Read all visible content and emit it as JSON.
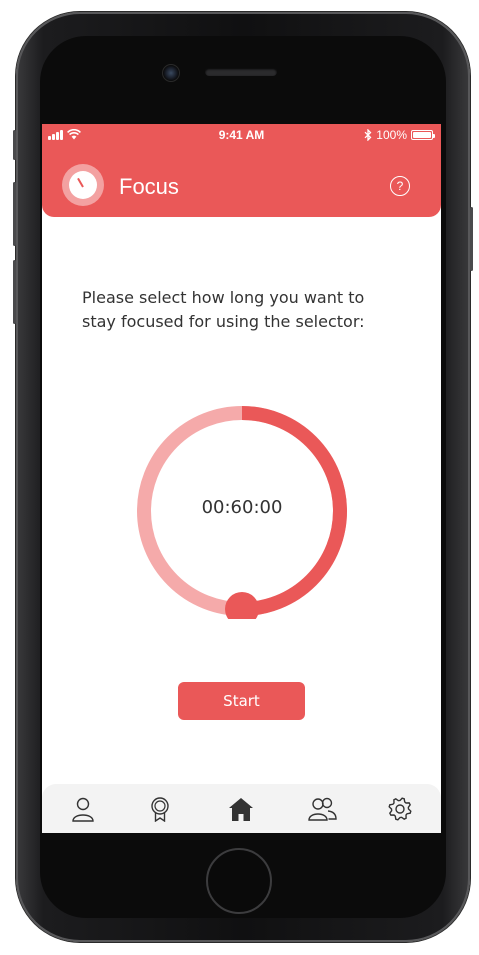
{
  "status_bar": {
    "time": "9:41 AM",
    "battery": "100%"
  },
  "header": {
    "title": "Focus",
    "help_glyph": "?",
    "icon": "stopwatch-icon"
  },
  "main": {
    "instructions": "Please select how long you want to stay focused for using the selector:",
    "timer_value": "00:60:00",
    "selector_level": 0.5,
    "start_label": "Start"
  },
  "tab_bar": {
    "tabs": [
      {
        "icon": "profile-icon",
        "active": false
      },
      {
        "icon": "award-icon",
        "active": false
      },
      {
        "icon": "home-icon",
        "active": true
      },
      {
        "icon": "community-icon",
        "active": false
      },
      {
        "icon": "settings-icon",
        "active": false
      }
    ]
  },
  "colors": {
    "accent": "#ea5858",
    "accent_light": "#f5aaaa",
    "text": "#333333",
    "tab_bar_bg": "#f3f3f3"
  }
}
